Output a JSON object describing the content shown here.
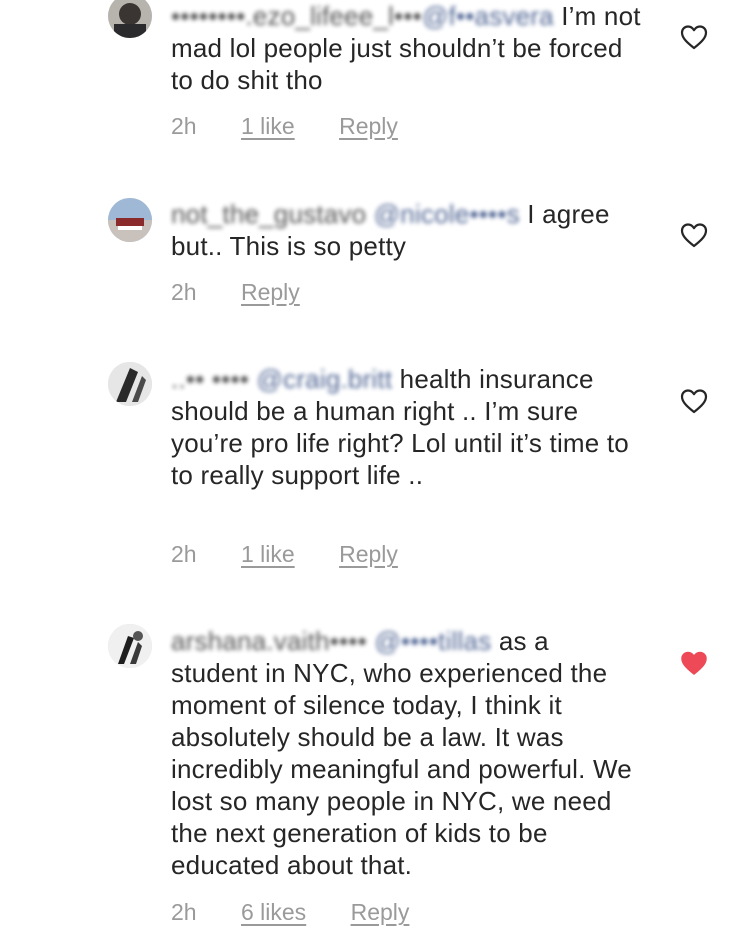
{
  "comments": [
    {
      "handle": "••••••••.ezo_lifeee_l•••",
      "mention": "@f••asvera",
      "text": " I’m not mad lol people just shouldn’t be forced to do shit tho",
      "time": "2h",
      "likes": "1 like",
      "reply": "Reply",
      "liked": false
    },
    {
      "handle": "not_the_gustavo",
      "mention": "@nicole••••s",
      "text": " I agree but.. This is so petty",
      "time": "2h",
      "likes": "",
      "reply": "Reply",
      "liked": false
    },
    {
      "handle": "..•• ••••",
      "mention": "@craig.britt",
      "text": " health insurance should be a human right .. I’m sure you’re pro life right? Lol until it’s time to to really support life ..",
      "time": "2h",
      "likes": "1 like",
      "reply": "Reply",
      "liked": false
    },
    {
      "handle": "arshana.vaith••••",
      "mention": "@••••tillas",
      "text": " as a student in NYC, who experienced the moment of silence today, I think it absolutely should be a law. It was incredibly meaningful and powerful. We lost so many people in NYC, we need the next generation of kids to be educated about that.",
      "time": "2h",
      "likes": "6 likes",
      "reply": "Reply",
      "liked": true
    }
  ],
  "colors": {
    "text": "#262626",
    "meta": "#9a9a9a",
    "mention": "#25407a",
    "liked_heart": "#ed4956",
    "heart_outline": "#262626"
  },
  "icons": {
    "heart_outline": "heart-outline-icon",
    "heart_filled": "heart-filled-icon"
  }
}
